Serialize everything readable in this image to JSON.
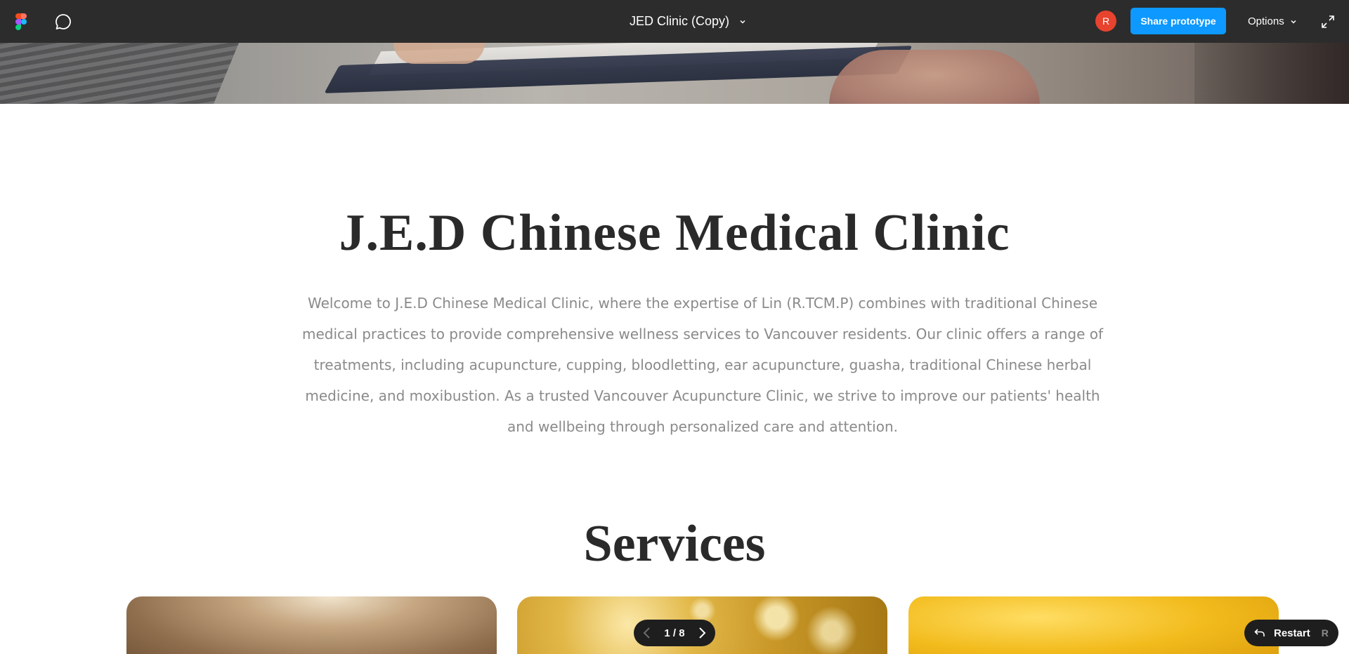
{
  "topbar": {
    "file_title": "JED Clinic (Copy)",
    "avatar_initial": "R",
    "avatar_color": "#e8432e",
    "share_label": "Share prototype",
    "share_color": "#0d99ff",
    "options_label": "Options",
    "icons": [
      "figma-logo-icon",
      "comment-icon",
      "chevron-down-icon",
      "expand-icon"
    ]
  },
  "hero": {
    "image_kind": "photo"
  },
  "content": {
    "clinic_title": "J.E.D Chinese Medical Clinic",
    "intro_text": "Welcome to J.E.D Chinese Medical Clinic, where the expertise of Lin (R.TCM.P) combines with traditional Chinese medical practices to provide comprehensive wellness services to Vancouver residents. Our clinic offers a range of treatments, including acupuncture, cupping, bloodletting, ear acupuncture, guasha, traditional Chinese herbal medicine, and moxibustion. As a trusted Vancouver Acupuncture Clinic, we strive to improve our patients' health and wellbeing through personalized care and attention.",
    "services_title": "Services"
  },
  "prototype": {
    "page_indicator": "1 / 8",
    "restart_label": "Restart",
    "restart_shortcut": "R"
  }
}
